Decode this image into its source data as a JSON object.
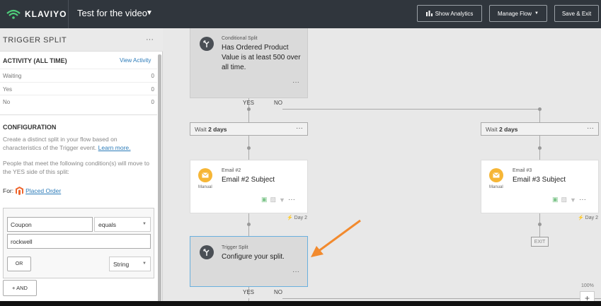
{
  "topbar": {
    "logo_text": "KLAVIYO",
    "flow_title": "Test for the video",
    "show_analytics": "Show Analytics",
    "manage_flow": "Manage Flow",
    "save_exit": "Save & Exit"
  },
  "sidebar": {
    "title": "TRIGGER SPLIT",
    "dots": "···",
    "activity_title": "ACTIVITY (ALL TIME)",
    "view_activity": "View Activity",
    "activity": [
      {
        "label": "Waiting",
        "value": "0"
      },
      {
        "label": "Yes",
        "value": "0"
      },
      {
        "label": "No",
        "value": "0"
      }
    ],
    "config_title": "CONFIGURATION",
    "config_text": "Create a distinct split in your flow based on characteristics of the Trigger event.",
    "learn_more": "Learn more.",
    "people_text": "People that meet the following condition(s) will move to the YES side of this split:",
    "for_label": "For:",
    "placed_order": "Placed Order",
    "field_value": "Coupon",
    "operator_value": "equals",
    "match_value": "rockwell",
    "or_label": "OR",
    "type_value": "String",
    "and_label": "+ AND"
  },
  "canvas": {
    "cond_split": {
      "type": "Conditional Split",
      "text": "Has Ordered Product Value is at least 500 over all time.",
      "dots": "···"
    },
    "yes": "YES",
    "no": "NO",
    "wait_left": {
      "prefix": "Wait",
      "value": "2 days",
      "dots": "···"
    },
    "wait_right": {
      "prefix": "Wait",
      "value": "2 days",
      "dots": "···"
    },
    "email2": {
      "type": "Email #2",
      "subject": "Email #2 Subject",
      "manual": "Manual",
      "day": "Day 2",
      "dots": "···"
    },
    "email3": {
      "type": "Email #3",
      "subject": "Email #3 Subject",
      "manual": "Manual",
      "day": "Day 2",
      "dots": "···"
    },
    "trigger_split": {
      "type": "Trigger Split",
      "text": "Configure your split.",
      "dots": "···"
    },
    "exit": "EXIT",
    "yes2": "YES",
    "no2": "NO",
    "zoom": "100%",
    "plus": "+"
  },
  "colors": {
    "topbar": "#30363d",
    "link": "#2b7bb9",
    "email_icon": "#f6b636",
    "arrow": "#f28a2e",
    "selection": "#6ab0de"
  }
}
